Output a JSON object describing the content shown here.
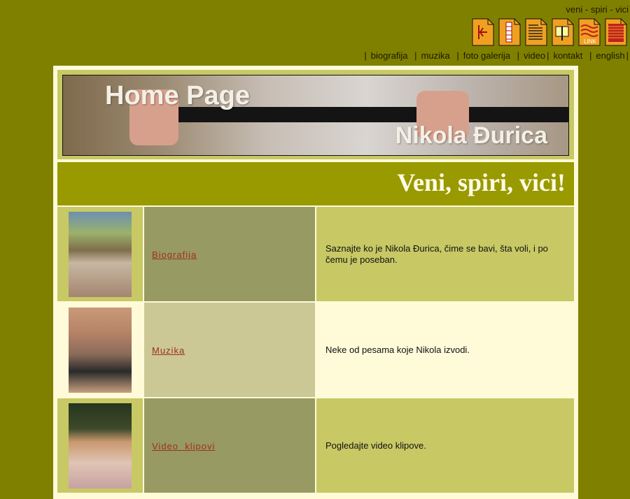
{
  "header": {
    "tagline": "veni - spiri - vici",
    "icons": [
      "document-map-icon",
      "document-columns-icon",
      "document-text-icon",
      "document-book-icon",
      "document-link-icon",
      "document-lines-icon"
    ],
    "icon_link_text": "LINK"
  },
  "topnav": {
    "items": [
      "biografija",
      "muzika",
      "foto galerija",
      "video",
      "kontakt",
      "english"
    ]
  },
  "banner": {
    "title": "Home Page",
    "name": "Nikola Đurica"
  },
  "headline": "Veni, spiri, vici!",
  "rows": [
    {
      "label": "Biografija",
      "desc": "Saznajte ko je Nikola Đurica, čime se bavi, šta voli, i po čemu je poseban."
    },
    {
      "label": "Muzika",
      "desc": "Neke od pesama koje Nikola izvodi."
    },
    {
      "label": "Video  klipovi",
      "desc": "Pogledajte video klipove."
    }
  ],
  "colors": {
    "page_bg": "#808000",
    "row_light": "#c8c865",
    "row_dark_label": "#979a62",
    "row_cream": "#fffbd9",
    "row_cream_label": "#cbc895",
    "link_red": "#a0301a"
  }
}
